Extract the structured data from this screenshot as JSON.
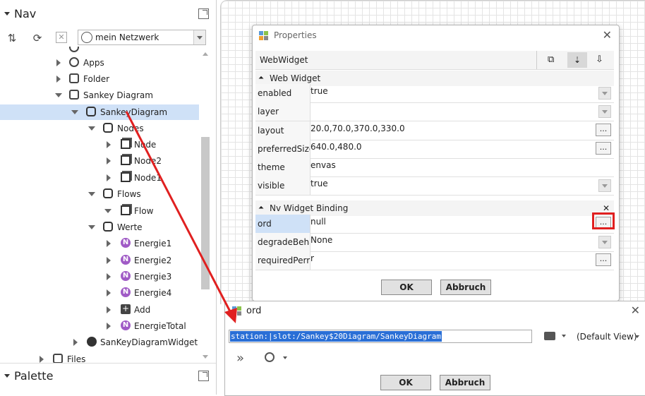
{
  "nav": {
    "title": "Nav",
    "network_select": "mein Netzwerk",
    "tree": [
      {
        "label": "Apps",
        "icon": "globe-icon"
      },
      {
        "label": "Folder",
        "icon": "folder-icon"
      },
      {
        "label": "Sankey Diagram",
        "icon": "folder-icon"
      },
      {
        "label": "SankeyDiagram",
        "icon": "component-icon"
      },
      {
        "label": "Nodes",
        "icon": "folder-icon"
      },
      {
        "label": "Node",
        "icon": "node-icon"
      },
      {
        "label": "Node2",
        "icon": "node-icon"
      },
      {
        "label": "Node1",
        "icon": "node-icon"
      },
      {
        "label": "Flows",
        "icon": "folder-icon"
      },
      {
        "label": "Flow",
        "icon": "node-icon"
      },
      {
        "label": "Werte",
        "icon": "folder-icon"
      },
      {
        "label": "Energie1",
        "icon": "numeric-icon"
      },
      {
        "label": "Energie2",
        "icon": "numeric-icon"
      },
      {
        "label": "Energie3",
        "icon": "numeric-icon"
      },
      {
        "label": "Energie4",
        "icon": "numeric-icon"
      },
      {
        "label": "Add",
        "icon": "add-icon"
      },
      {
        "label": "EnergieTotal",
        "icon": "numeric-icon"
      },
      {
        "label": "SanKeyDiagramWidget",
        "icon": "widget-icon"
      },
      {
        "label": "Files",
        "icon": "folder-icon"
      }
    ]
  },
  "palette": {
    "title": "Palette"
  },
  "properties": {
    "title": "Properties",
    "widget_name": "WebWidget",
    "sections": {
      "web_widget": "Web Widget",
      "nv_binding": "Nv Widget Binding"
    },
    "rows": [
      {
        "name": "enabled",
        "value": "true"
      },
      {
        "name": "layer",
        "value": ""
      },
      {
        "name": "layout",
        "value": "20.0,70.0,370.0,330.0"
      },
      {
        "name": "preferredSize",
        "value": "640.0,480.0"
      },
      {
        "name": "theme",
        "value": "envas"
      },
      {
        "name": "visible",
        "value": "true"
      },
      {
        "name": "ord",
        "value": "null"
      },
      {
        "name": "degradeBehav",
        "value": "None"
      },
      {
        "name": "requiredPerm",
        "value": "r"
      }
    ],
    "ok": "OK",
    "cancel": "Abbruch",
    "ellipsis": "..."
  },
  "ord_dialog": {
    "title": "ord",
    "value": "station:|slot:/Sankey$20Diagram/SankeyDiagram",
    "view": "(Default View)",
    "ok": "OK",
    "cancel": "Abbruch"
  },
  "colors": {
    "highlight": "#2a6fd6",
    "annotation": "#e02020",
    "selected_row": "#cfe1f7"
  }
}
